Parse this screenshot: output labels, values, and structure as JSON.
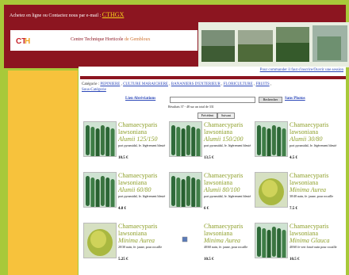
{
  "header": {
    "contact_text": "Achetez en ligne ou Contactez nous par e-mail : ",
    "email_link": "CTHGX",
    "org_name_part1": "Centre Technique Horticole ",
    "org_name_part2": "de Gembloux"
  },
  "content": {
    "order_link": "Pour commander il faut s'inscrire/Ouvrir une session",
    "categories_label": "Catégorie : ",
    "categories": [
      "PEPINIERE",
      "CULTURE MARAICHERE",
      "BANANIERS D'EXTERIEUR",
      "FLORICULTURE",
      "FRUITS"
    ],
    "sous_categorie": "Sous-Catégorie",
    "search": {
      "lien_abreviations": "Lien Abréviations",
      "button": "Rechercher",
      "sans_photos": "Sans Photos",
      "placeholder": ""
    },
    "result_text": "Résultats 37 - 48 sur un total de 331",
    "prev": "Précédent",
    "next": "Suivant"
  },
  "products": [
    {
      "name": "Chamaecyparis lawsoniana",
      "cultivar": "Alumii 125/150",
      "desc": "port pyramidal, fe. légèrement bleuté",
      "price": "10.5 €",
      "photo": "cypress"
    },
    {
      "name": "Chamaecyparis lawsoniana",
      "cultivar": "Alumii 150/200",
      "desc": "port pyramidal, fe. légèrement bleuté",
      "price": "13.5 €",
      "photo": "cypress"
    },
    {
      "name": "Chamaecyparis lawsoniana",
      "cultivar": "Alumii 30/80",
      "desc": "port pyramidal, fe. légèrement bleuté",
      "price": "4.5 €",
      "photo": "cypress"
    },
    {
      "name": "Chamaecyparis lawsoniana",
      "cultivar": "Alumii 60/80",
      "desc": "port pyramidal, fe. légèrement bleuté",
      "price": "4.8 €",
      "photo": "cypress"
    },
    {
      "name": "Chamaecyparis lawsoniana",
      "cultivar": "Alumii 80/100",
      "desc": "port pyramidal, fe. légèrement bleuté",
      "price": "6 €",
      "photo": "cypress"
    },
    {
      "name": "Chamaecyparis lawsoniana",
      "cultivar": "Minima Aurea",
      "desc": "30/40 nain, fe. jaune, pour rocaille",
      "price": "7.5 €",
      "photo": "golden"
    },
    {
      "name": "Chamaecyparis lawsoniana",
      "cultivar": "Minima Aurea",
      "desc": "20/30 nain, fe. jaune, pour rocaille",
      "price": "5.25 €",
      "photo": "golden"
    },
    {
      "name": "Chamaecyparis lawsoniana",
      "cultivar": "Minima Aurea",
      "desc": "40/60 nain, fe. jaune, pour rocaille",
      "price": "10.5 €",
      "photo": "missing"
    },
    {
      "name": "Chamaecyparis lawsoniana",
      "cultivar": "Minima Glauca",
      "desc": "40/60 fe vert foncé nain pour rocaille",
      "price": "10.5 €",
      "photo": "cypress"
    }
  ],
  "colors": {
    "header_bg": "#8c1520",
    "outer_bg": "#a8c93a",
    "sidebar_bg": "#f7c23c",
    "product_name": "#8fa02c",
    "link_blue": "#2a46b8"
  }
}
